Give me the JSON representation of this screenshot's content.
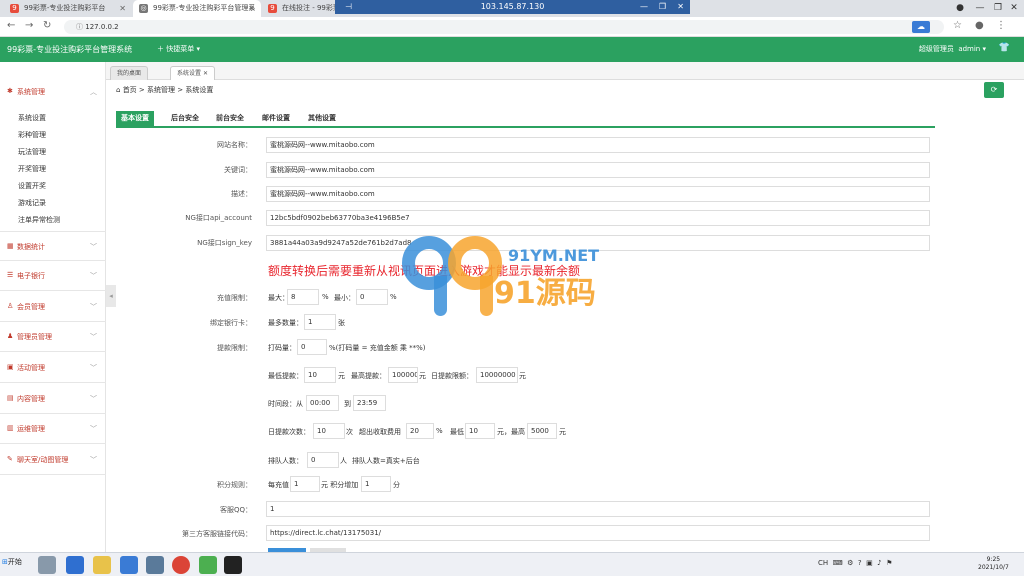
{
  "browser": {
    "tabs": [
      {
        "label": "99彩票-专业投注购彩平台"
      },
      {
        "label": "99彩票-专业投注购彩平台管理系"
      },
      {
        "label": "在线投注 - 99彩票"
      }
    ],
    "url": "127.0.0.2",
    "remote_ip": "103.145.87.130"
  },
  "app": {
    "title": "99彩票-专业投注购彩平台管理系统",
    "quick_menu": "快捷菜单",
    "admin_label": "超级管理员",
    "admin_name": "admin"
  },
  "sidebar": {
    "groups": [
      {
        "label": "系统管理"
      },
      {
        "label": "数据统计"
      },
      {
        "label": "电子银行"
      },
      {
        "label": "会员管理"
      },
      {
        "label": "管理员管理"
      },
      {
        "label": "活动管理"
      },
      {
        "label": "内容管理"
      },
      {
        "label": "运维管理"
      },
      {
        "label": "聊天室/动图管理"
      }
    ],
    "subitems": [
      "系统设置",
      "彩种管理",
      "玩法管理",
      "开奖管理",
      "设置开奖",
      "游戏记录",
      "注单异常检测"
    ]
  },
  "page_tabs": [
    "我的桌面",
    "系统设置"
  ],
  "breadcrumb": {
    "home": "首页",
    "sep": ">",
    "section": "系统管理",
    "page": "系统设置"
  },
  "settings_tabs": [
    "基本设置",
    "后台安全",
    "前台安全",
    "邮件设置",
    "其他设置"
  ],
  "form": {
    "site_name_label": "网站名称：",
    "site_name": "蜜桃源码网--www.mitaobo.com",
    "keywords_label": "关键词：",
    "keywords": "蜜桃源码网--www.mitaobo.com",
    "description_label": "描述：",
    "description": "蜜桃源码网--www.mitaobo.com",
    "ng_account_label": "NG接口api_account",
    "ng_account": "12bc5bdf0902beb63770ba3e4196B5e7",
    "ng_key_label": "NG接口sign_key",
    "ng_key": "3881a44a03a9d9247a52de761b2d7ad8",
    "notice": "额度转换后需要重新从视讯页面进入游戏才能显示最新余额",
    "recharge_label": "充值限制：",
    "recharge_max_label": "最大：",
    "recharge_max": "8",
    "pct": "%",
    "recharge_min_label": "最小：",
    "recharge_min": "0",
    "bind_card_label": "绑定银行卡：",
    "bind_card_prefix": "最多数量：",
    "bind_card_count": "1",
    "bind_card_unit": "张",
    "withdraw_label": "提款限制：",
    "bet_amount_label": "打码量：",
    "bet_amount": "0",
    "bet_amount_note": "%(打码量 = 充值金额 乘 **%)",
    "min_withdraw_label": "最低提款：",
    "min_withdraw": "10",
    "yuan": "元",
    "max_withdraw_label": "最高提款：",
    "max_withdraw": "1000000",
    "daily_limit_label": "日提款限额：",
    "daily_limit": "10000000",
    "time_label": "时间段：从",
    "time_from": "00:00",
    "time_to_label": "到",
    "time_to": "23:59",
    "daily_count_label": "日提款次数：",
    "daily_count": "10",
    "times_unit": "次",
    "over_fee_label": "超出收取费用",
    "over_fee": "20",
    "min_fee_label": "最低",
    "min_fee": "10",
    "max_fee_sep": "元，最高",
    "max_fee": "5000",
    "queue_label": "排队人数：",
    "queue_count": "0",
    "queue_unit": "人",
    "queue_note": "排队人数=真实+后台",
    "points_label": "积分规则：",
    "points_per_label": "每充值",
    "points_per": "1",
    "points_add_label": "元 积分增加",
    "points_add": "1",
    "points_unit": "分",
    "qq_label": "客服QQ：",
    "qq": "1",
    "cs_code_label": "第三方客服链接代码：",
    "cs_code": "https://direct.lc.chat/13175031/"
  },
  "watermark": {
    "line1": "91YM.NET",
    "line2": "91源码"
  },
  "taskbar": {
    "start": "开始",
    "tray_lang": "CH",
    "time": "9:25",
    "date": "2021/10/7"
  },
  "colors": {
    "brand_green": "#2ba160",
    "notice_red": "#e8262e",
    "menu_red": "#c0392b"
  }
}
